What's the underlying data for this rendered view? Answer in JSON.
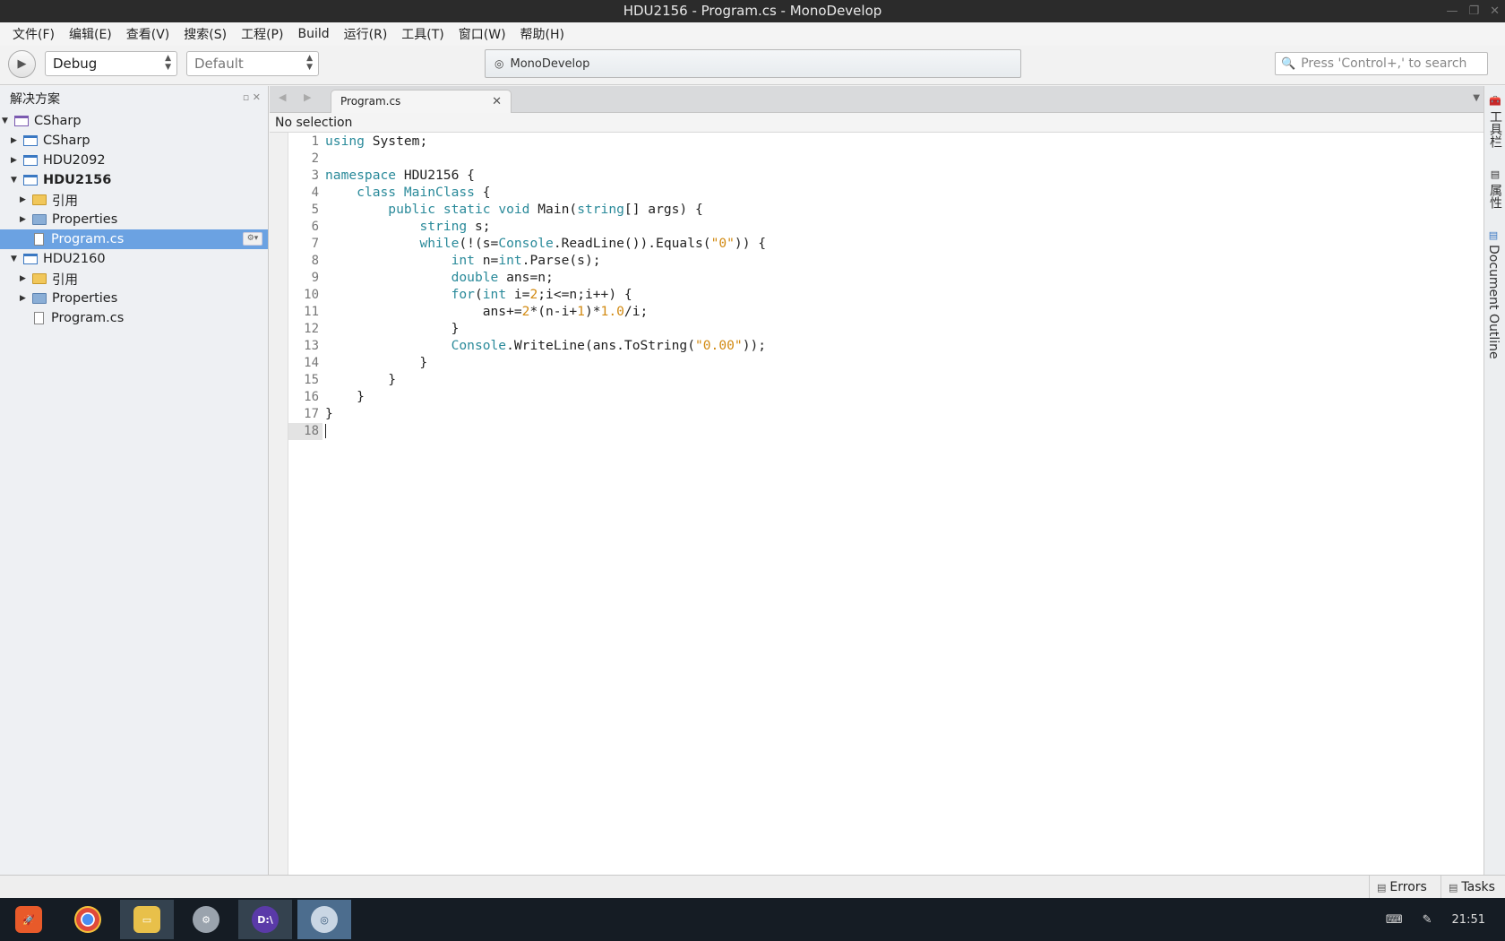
{
  "window": {
    "title": "HDU2156 - Program.cs - MonoDevelop",
    "controls": [
      "—",
      "❐",
      "✕"
    ]
  },
  "menu": [
    "文件(F)",
    "编辑(E)",
    "查看(V)",
    "搜索(S)",
    "工程(P)",
    "Build",
    "运行(R)",
    "工具(T)",
    "窗口(W)",
    "帮助(H)"
  ],
  "toolbar": {
    "config": "Debug",
    "platform": "Default",
    "status": "MonoDevelop",
    "search_placeholder": "Press 'Control+,' to search"
  },
  "solution_pad": {
    "title": "解决方案",
    "items": [
      {
        "label": "CSharp",
        "level": 0,
        "expanded": true,
        "icon": "solution-icon"
      },
      {
        "label": "CSharp",
        "level": 1,
        "expanded": false,
        "icon": "project-icon"
      },
      {
        "label": "HDU2092",
        "level": 1,
        "expanded": false,
        "icon": "project-icon"
      },
      {
        "label": "HDU2156",
        "level": 1,
        "expanded": true,
        "icon": "project-icon",
        "bold": true
      },
      {
        "label": "引用",
        "level": 2,
        "expanded": false,
        "icon": "folder-icon"
      },
      {
        "label": "Properties",
        "level": 2,
        "expanded": false,
        "icon": "properties-folder-icon"
      },
      {
        "label": "Program.cs",
        "level": 2,
        "icon": "file-icon",
        "selected": true
      },
      {
        "label": "HDU2160",
        "level": 1,
        "expanded": true,
        "icon": "project-icon"
      },
      {
        "label": "引用",
        "level": 2,
        "expanded": false,
        "icon": "folder-icon"
      },
      {
        "label": "Properties",
        "level": 2,
        "expanded": false,
        "icon": "properties-folder-icon"
      },
      {
        "label": "Program.cs",
        "level": 2,
        "icon": "file-icon"
      }
    ]
  },
  "editor": {
    "tab": "Program.cs",
    "path": "No selection",
    "lines": [
      "using System;",
      "",
      "namespace HDU2156 {",
      "    class MainClass {",
      "        public static void Main(string[] args) {",
      "            string s;",
      "            while(!(s=Console.ReadLine()).Equals(\"0\")) {",
      "                int n=int.Parse(s);",
      "                double ans=n;",
      "                for(int i=2;i<=n;i++) {",
      "                    ans+=2*(n-i+1)*1.0/i;",
      "                }",
      "                Console.WriteLine(ans.ToString(\"0.00\"));",
      "            }",
      "        }",
      "    }",
      "}",
      ""
    ],
    "current_line": 18
  },
  "right_pads": [
    "工具栏",
    "属性",
    "Document Outline"
  ],
  "bottom": {
    "errors": "Errors",
    "tasks": "Tasks"
  },
  "taskbar": {
    "clock": "21:51",
    "apps": [
      "launcher",
      "chrome",
      "files",
      "settings",
      "deepin-terminal",
      "monodevelop"
    ]
  }
}
